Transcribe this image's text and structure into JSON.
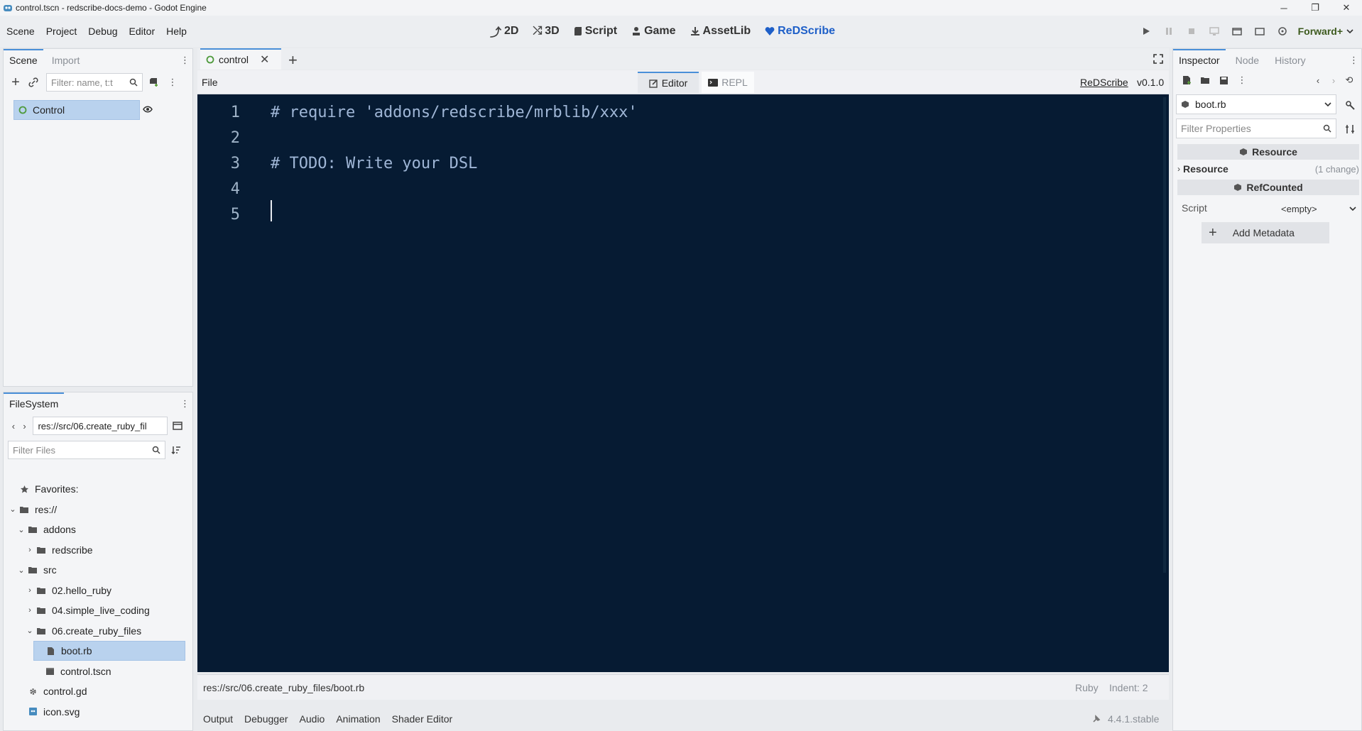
{
  "window": {
    "title": "control.tscn - redscribe-docs-demo - Godot Engine",
    "controls": [
      "─",
      "❐",
      "✕"
    ]
  },
  "menu": [
    "Scene",
    "Project",
    "Debug",
    "Editor",
    "Help"
  ],
  "workspaces": [
    {
      "label": "2D",
      "icon": "2d-icon"
    },
    {
      "label": "3D",
      "icon": "3d-icon"
    },
    {
      "label": "Script",
      "icon": "script-icon"
    },
    {
      "label": "Game",
      "icon": "game-icon"
    },
    {
      "label": "AssetLib",
      "icon": "assetlib-icon"
    },
    {
      "label": "ReDScribe",
      "icon": "heart-icon"
    }
  ],
  "renderer": "Forward+",
  "scene_dock": {
    "tabs": [
      "Scene",
      "Import"
    ],
    "filter_placeholder": "Filter: name, t:t",
    "root_node": "Control"
  },
  "filesystem": {
    "tab": "FileSystem",
    "path": "res://src/06.create_ruby_fil",
    "filter_placeholder": "Filter Files",
    "tree": [
      {
        "label": "Favorites:",
        "depth": 0,
        "kind": "star",
        "arrow": ""
      },
      {
        "label": "res://",
        "depth": 0,
        "kind": "folder",
        "arrow": "v"
      },
      {
        "label": "addons",
        "depth": 1,
        "kind": "folder",
        "arrow": "v"
      },
      {
        "label": "redscribe",
        "depth": 2,
        "kind": "folder",
        "arrow": ">"
      },
      {
        "label": "src",
        "depth": 1,
        "kind": "folder",
        "arrow": "v"
      },
      {
        "label": "02.hello_ruby",
        "depth": 2,
        "kind": "folder",
        "arrow": ">"
      },
      {
        "label": "04.simple_live_coding",
        "depth": 2,
        "kind": "folder",
        "arrow": ">"
      },
      {
        "label": "06.create_ruby_files",
        "depth": 2,
        "kind": "folder",
        "arrow": "v"
      },
      {
        "label": "boot.rb",
        "depth": 3,
        "kind": "file",
        "arrow": "",
        "selected": true
      },
      {
        "label": "control.tscn",
        "depth": 3,
        "kind": "scene",
        "arrow": ""
      },
      {
        "label": "control.gd",
        "depth": 1,
        "kind": "gear",
        "arrow": ""
      },
      {
        "label": "icon.svg",
        "depth": 1,
        "kind": "image",
        "arrow": ""
      }
    ]
  },
  "editor": {
    "scene_tab": "control",
    "file_menu": "File",
    "mode_tabs": [
      "Editor",
      "REPL"
    ],
    "plugin_name": "ReDScribe",
    "version": "v0.1.0",
    "lines": [
      {
        "n": "1",
        "text": "# require 'addons/redscribe/mrblib/xxx'"
      },
      {
        "n": "2",
        "text": ""
      },
      {
        "n": "3",
        "text": "# TODO: Write your DSL"
      },
      {
        "n": "4",
        "text": ""
      },
      {
        "n": "5",
        "text": ""
      }
    ],
    "file_path": "res://src/06.create_ruby_files/boot.rb",
    "language": "Ruby",
    "indent": "Indent: 2"
  },
  "bottom_panel": {
    "tabs": [
      "Output",
      "Debugger",
      "Audio",
      "Animation",
      "Shader Editor"
    ],
    "engine_version": "4.4.1.stable"
  },
  "inspector": {
    "tabs": [
      "Inspector",
      "Node",
      "History"
    ],
    "resource": "boot.rb",
    "filter_placeholder": "Filter Properties",
    "section_resource": "Resource",
    "group_resource": "Resource",
    "group_changes": "(1 change)",
    "section_refcounted": "RefCounted",
    "script_label": "Script",
    "script_value": "<empty>",
    "add_metadata": "Add Metadata"
  }
}
